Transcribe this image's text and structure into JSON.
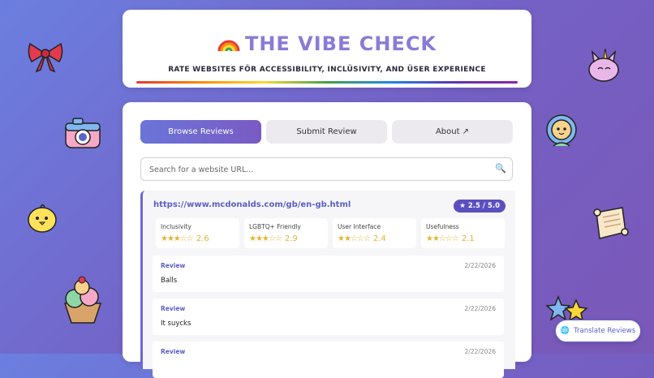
{
  "header": {
    "title": "THE VIBE CHECK",
    "subtitle": "RATE WEBSITES FÖR ACCESSIBILITY, INCLÜSIVITY, AND ÜSER EXPERIENCE"
  },
  "tabs": [
    {
      "label": "Browse Reviews",
      "active": true
    },
    {
      "label": "Submit Review",
      "active": false
    },
    {
      "label": "About ↗",
      "active": false
    }
  ],
  "search": {
    "placeholder": "Search for a website URL...",
    "value": ""
  },
  "review": {
    "url": "https://www.mcdonalds.com/gb/en-gb.html",
    "rating": "★ 2.5 / 5.0",
    "metrics": [
      {
        "label": "Inclusivity",
        "stars": "★★★☆☆",
        "value": "2.6"
      },
      {
        "label": "LGBTQ+ Friendly",
        "stars": "★★★☆☆",
        "value": "2.9"
      },
      {
        "label": "User Interface",
        "stars": "★★☆☆☆",
        "value": "2.4"
      },
      {
        "label": "Usefulness",
        "stars": "★★☆☆☆",
        "value": "2.1"
      }
    ],
    "comments": [
      {
        "label": "Review",
        "date": "2/22/2026",
        "text": "Balls"
      },
      {
        "label": "Review",
        "date": "2/22/2026",
        "text": "It suycks"
      },
      {
        "label": "Review",
        "date": "2/22/2026",
        "text": ""
      }
    ]
  },
  "translate": {
    "label": "Translate Reviews",
    "icon": "globe-icon"
  },
  "stickers": [
    "bow-sticker",
    "camera-sticker",
    "chick-sticker",
    "icecream-sticker",
    "unicorn-cat-sticker",
    "lion-sticker",
    "scroll-sticker",
    "stars-sticker"
  ]
}
